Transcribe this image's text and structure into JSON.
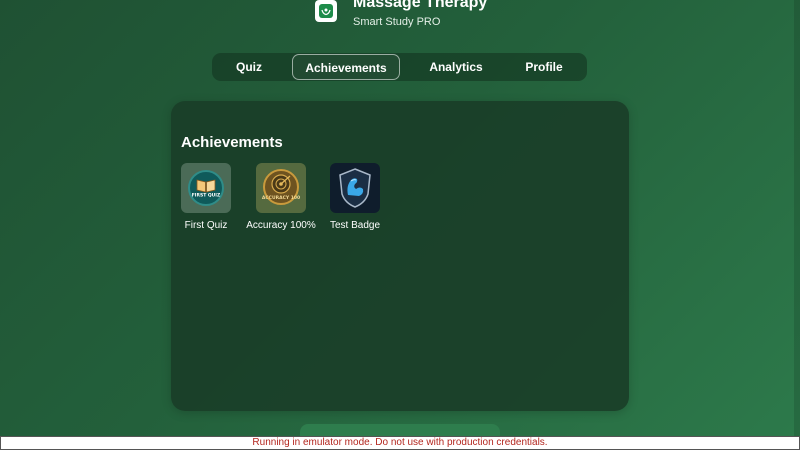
{
  "app": {
    "title": "Massage Therapy",
    "subtitle": "Smart Study PRO",
    "icon": "hands-logo-icon"
  },
  "tabs": [
    {
      "label": "Quiz",
      "active": false
    },
    {
      "label": "Achievements",
      "active": true
    },
    {
      "label": "Analytics",
      "active": false
    },
    {
      "label": "Profile",
      "active": false
    }
  ],
  "panel": {
    "title": "Achievements",
    "badges": [
      {
        "label": "First Quiz",
        "icon": "open-book-badge-icon",
        "badge_text": "FIRST QUIZ"
      },
      {
        "label": "Accuracy 100%",
        "icon": "target-badge-icon",
        "badge_text": "ACCURACY 100"
      },
      {
        "label": "Test Badge",
        "icon": "flexed-arm-shield-icon"
      }
    ]
  },
  "emulator_notice": "Running in emulator mode. Do not use with production credentials.",
  "colors": {
    "accent": "#2e7d4d",
    "background": "#23603b",
    "panel": "#1a3e28",
    "notice_text": "#b3261e"
  }
}
